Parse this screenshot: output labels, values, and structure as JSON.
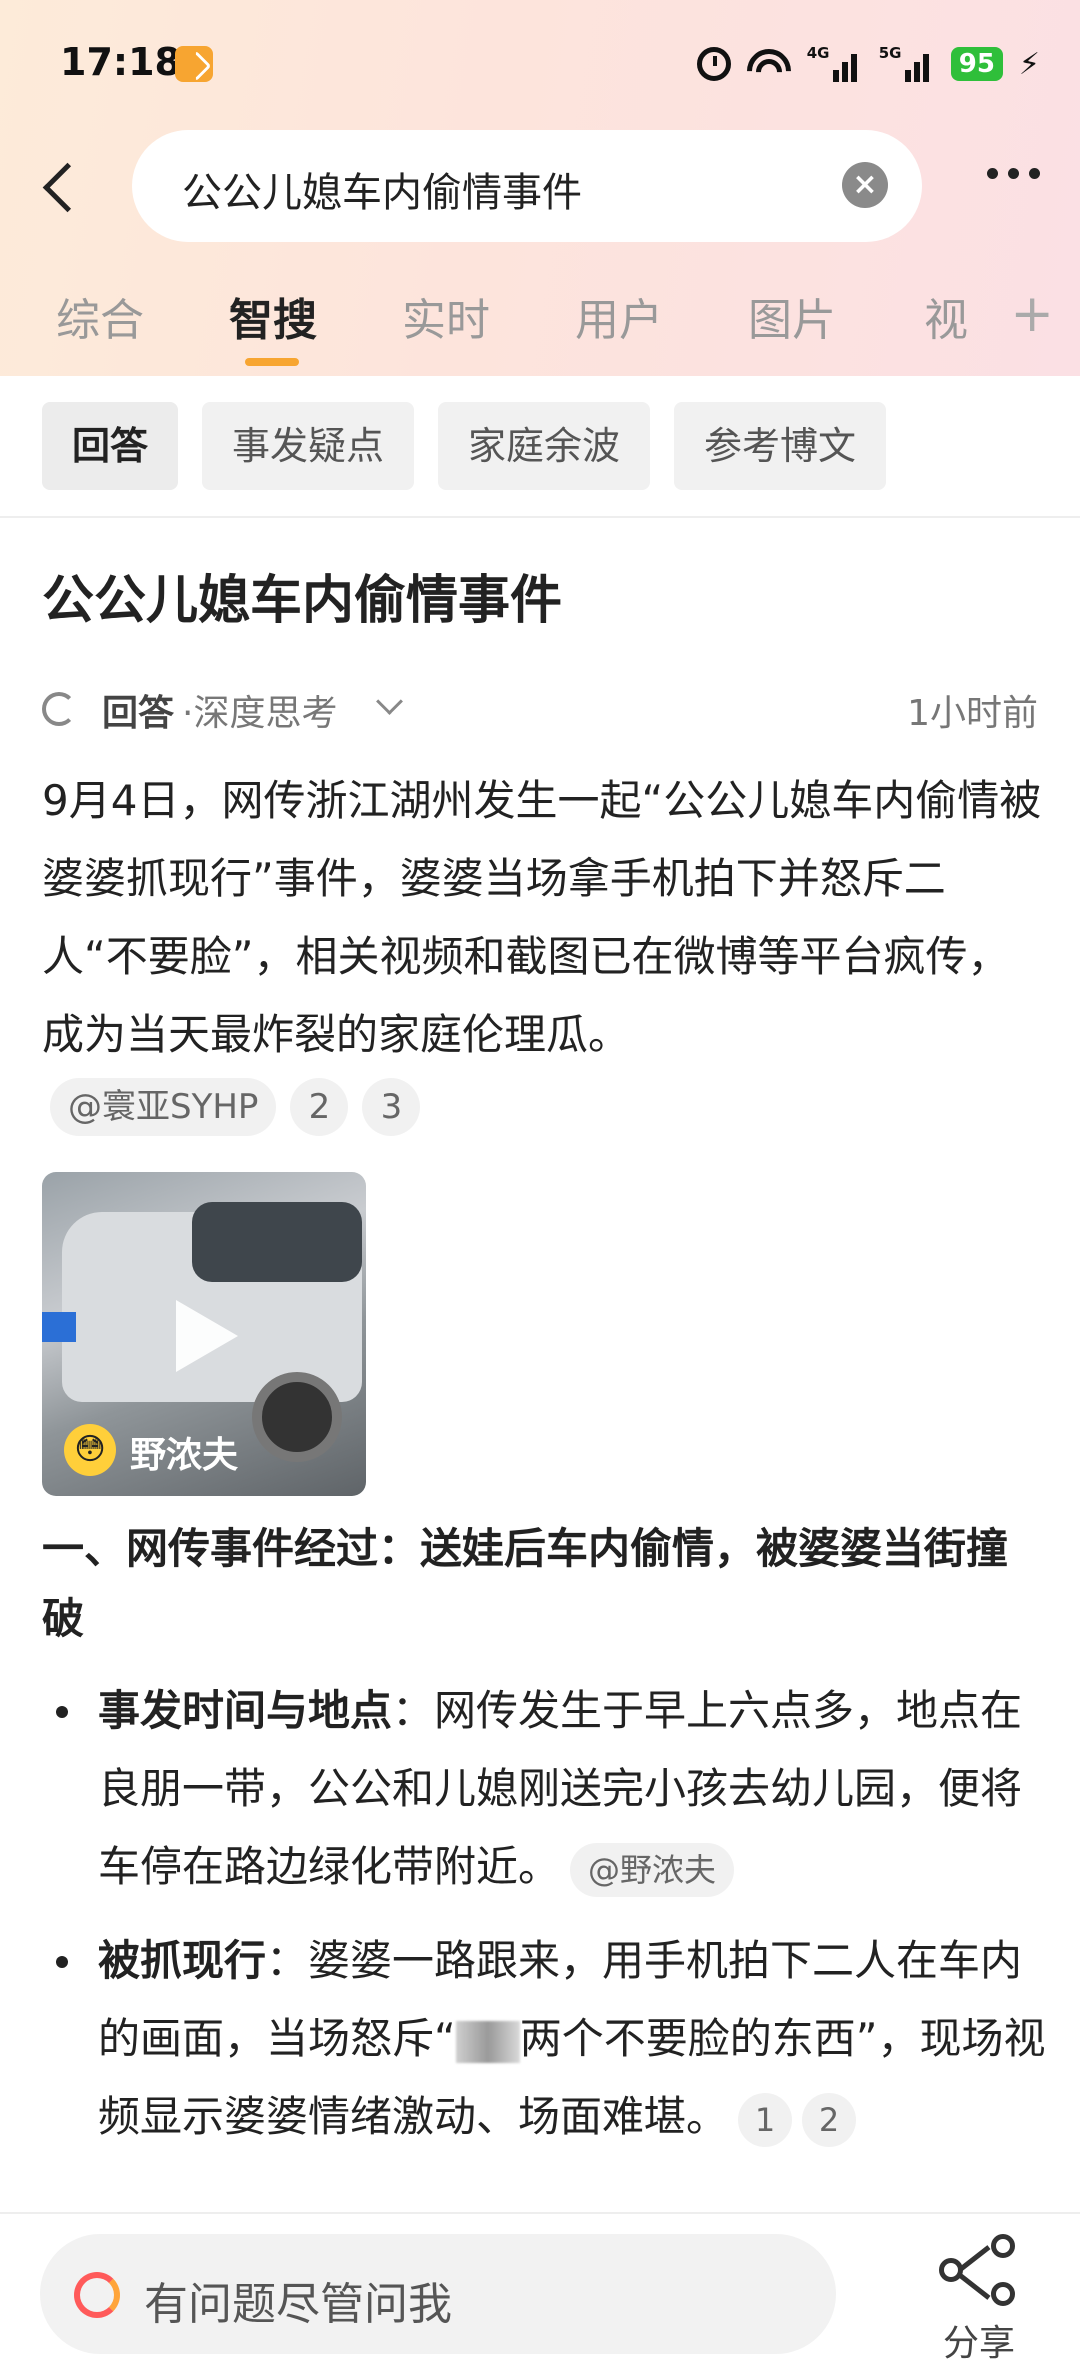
{
  "status_bar": {
    "time": "17:18",
    "network_1": "4G",
    "network_2": "5G",
    "battery": "95"
  },
  "search": {
    "query": "公公儿媳车内偷情事件"
  },
  "tabs": [
    {
      "label": "综合"
    },
    {
      "label": "智搜"
    },
    {
      "label": "实时"
    },
    {
      "label": "用户"
    },
    {
      "label": "图片"
    },
    {
      "label": "视"
    }
  ],
  "tabs_active": "智搜",
  "chips": [
    {
      "label": "回答"
    },
    {
      "label": "事发疑点"
    },
    {
      "label": "家庭余波"
    },
    {
      "label": "参考博文"
    }
  ],
  "answer": {
    "title": "公公儿媳车内偷情事件",
    "meta_label": "回答",
    "meta_sub": "·深度思考",
    "meta_time": "1小时前",
    "intro": "9月4日，网传浙江湖州发生一起“公公儿媳车内偷情被婆婆抓现行”事件，婆婆当场拿手机拍下并怒斥二人“不要脸”，相关视频和截图已在微博等平台疯传，成为当天最炸裂的家庭伦理瓜。",
    "intro_refs": {
      "source": "@寰亚SYHP",
      "n1": "2",
      "n2": "3"
    },
    "video": {
      "author": "野浓夫"
    },
    "section_title": "一、网传事件经过：送娃后车内偷情，被婆婆当街撞破",
    "bullets": [
      {
        "bold": "事发时间与地点",
        "text": "：网传发生于早上六点多，地点在良朋一带，公公和儿媳刚送完小孩去幼儿园，便将车停在路边绿化带附近。",
        "ref": "@野浓夫"
      },
      {
        "bold": "被抓现行",
        "text_a": "：婆婆一路跟来，用手机拍下二人在车内的画面，当场怒斥“",
        "text_b": "两个不要脸的东西”，现场视频显示婆婆情绪激动、场面难堪。",
        "n1": "1",
        "n2": "2"
      }
    ]
  },
  "bottom": {
    "ask_placeholder": "有问题尽管问我",
    "share_label": "分享"
  },
  "colors": {
    "accent": "#f7a531",
    "battery": "#2fbf3a"
  }
}
